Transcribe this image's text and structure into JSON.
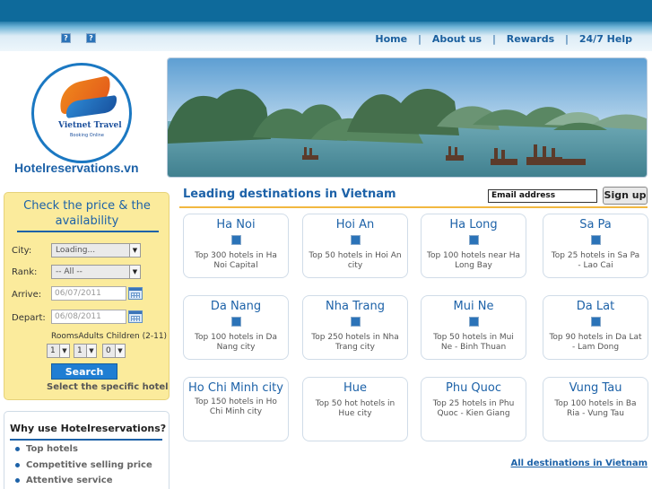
{
  "header": {
    "nav": [
      {
        "label": "Home"
      },
      {
        "label": "About us"
      },
      {
        "label": "Rewards"
      },
      {
        "label": "24/7 Help"
      }
    ],
    "nav_separator": "|",
    "flag_glyph": "?"
  },
  "logo": {
    "brand": "Vietnet Travel",
    "tagline": "Booking Online",
    "site_name": "Hotelreservations.vn"
  },
  "search": {
    "title": "Check the price & the availability",
    "city_label": "City:",
    "city_value": "Loading...",
    "rank_label": "Rank:",
    "rank_value": "-- All --",
    "arrive_label": "Arrive:",
    "arrive_value": "06/07/2011",
    "depart_label": "Depart:",
    "depart_value": "06/08/2011",
    "rooms_label": "RoomsAdults Children (2-11)",
    "rooms_value": "1",
    "adults_value": "1",
    "children_value": "0",
    "button_label": "Search",
    "specific_label": "Select the specific hotel"
  },
  "why": {
    "title": "Why use Hotelreservations?",
    "items": [
      "Top hotels",
      "Competitive selling price",
      "Attentive service"
    ]
  },
  "destinations": {
    "heading": "Leading destinations in Vietnam",
    "email_placeholder": "Email address",
    "signup_label": "Sign up",
    "cards": [
      {
        "name": "Ha Noi",
        "desc": "Top 300 hotels in Ha Noi Capital"
      },
      {
        "name": "Hoi An",
        "desc": "Top 50 hotels in Hoi An city"
      },
      {
        "name": "Ha Long",
        "desc": "Top 100 hotels near Ha Long Bay"
      },
      {
        "name": "Sa Pa",
        "desc": "Top 25 hotels in Sa Pa - Lao Cai"
      },
      {
        "name": "Da Nang",
        "desc": "Top 100 hotels in Da Nang city"
      },
      {
        "name": "Nha Trang",
        "desc": "Top 250 hotels in Nha Trang city"
      },
      {
        "name": "Mui Ne",
        "desc": "Top 50 hotels in Mui Ne - Binh Thuan"
      },
      {
        "name": "Da Lat",
        "desc": "Top 90 hotels in Da Lat - Lam Dong"
      },
      {
        "name": "Ho Chi Minh city",
        "desc": "Top 150 hotels in Ho Chi Minh city"
      },
      {
        "name": "Hue",
        "desc": "Top 50 hot hotels in Hue city"
      },
      {
        "name": "Phu Quoc",
        "desc": "Top 25 hotels in Phu Quoc - Kien Giang"
      },
      {
        "name": "Vung Tau",
        "desc": "Top 100 hotels in Ba Ria - Vung Tau"
      }
    ],
    "all_link": "All destinations in Vietnam"
  },
  "colors": {
    "brand_blue": "#1d62a8",
    "topbar": "#0e6a9b",
    "search_bg": "#fbeb9c",
    "accent_orange": "#f2b840"
  }
}
